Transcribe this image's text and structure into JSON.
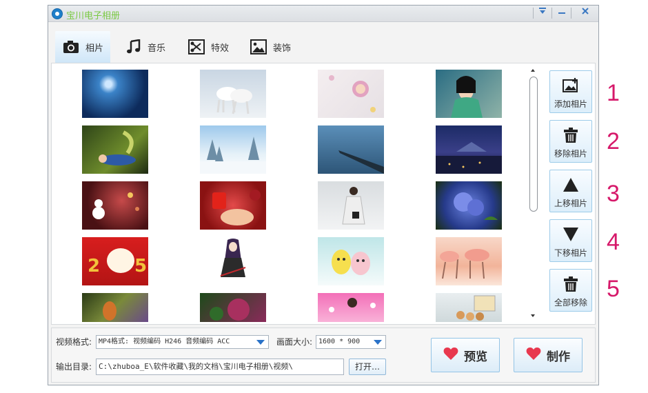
{
  "window": {
    "title": "宝川电子相册",
    "controls": [
      "dropdown-icon",
      "minimize-icon",
      "close-icon"
    ]
  },
  "tabs": [
    {
      "label": "相片",
      "icon": "camera-icon",
      "active": true
    },
    {
      "label": "音乐",
      "icon": "music-note-icon",
      "active": false
    },
    {
      "label": "特效",
      "icon": "scissors-icon",
      "active": false
    },
    {
      "label": "装饰",
      "icon": "image-icon",
      "active": false
    }
  ],
  "side_buttons": [
    {
      "label": "添加相片",
      "icon": "add-image-icon"
    },
    {
      "label": "移除相片",
      "icon": "trash-icon"
    },
    {
      "label": "上移相片",
      "icon": "triangle-up-icon"
    },
    {
      "label": "下移相片",
      "icon": "triangle-down-icon"
    },
    {
      "label": "全部移除",
      "icon": "trash-icon"
    }
  ],
  "annotations": [
    "1",
    "2",
    "3",
    "4",
    "5"
  ],
  "settings": {
    "format_label": "视频格式:",
    "format_value": "MP4格式: 视频编码 H246 音频编码 ACC",
    "size_label": "画面大小:",
    "size_value": "1600 * 900",
    "output_label": "输出目录:",
    "output_path": "C:\\zhuboa_E\\软件收藏\\我的文档\\宝川电子相册\\视频\\",
    "open_label": "打开…"
  },
  "actions": {
    "preview_label": "预览",
    "make_label": "制作"
  },
  "colors": {
    "title_text": "#7ac943",
    "accent_blue": "#2a72c8",
    "heart_red": "#e8384f",
    "annotation": "#d6196a"
  }
}
